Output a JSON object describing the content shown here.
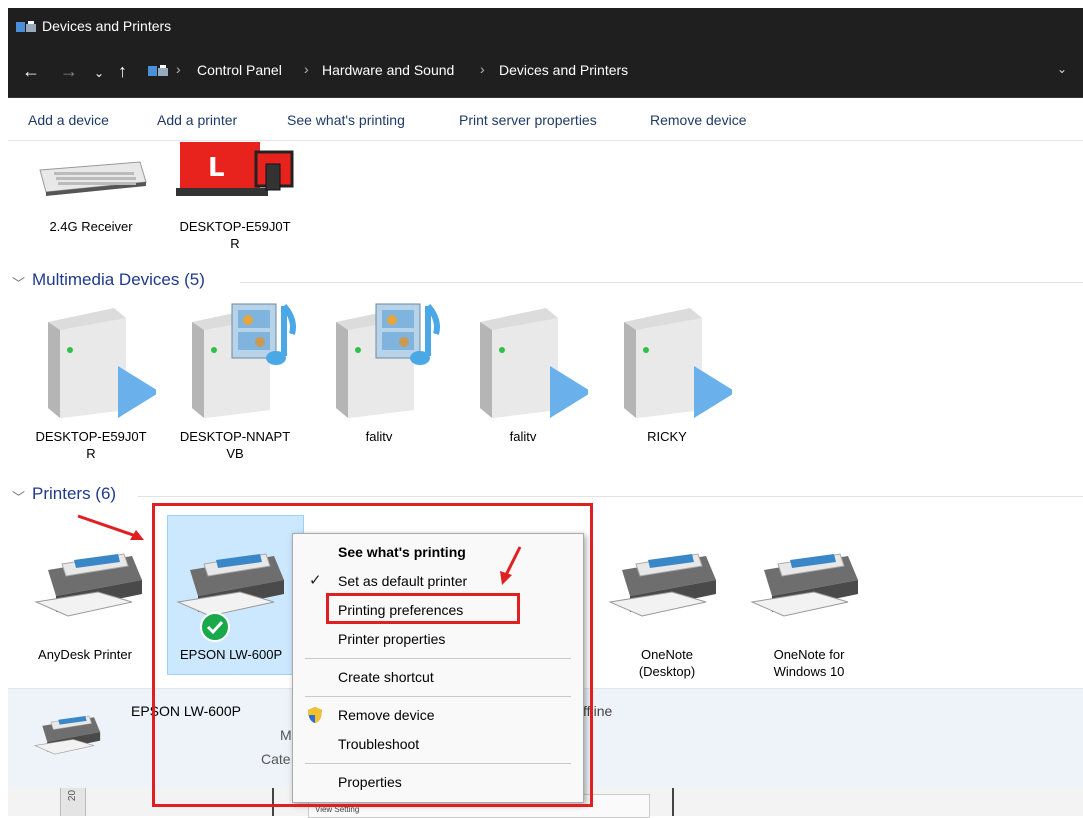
{
  "window": {
    "title": "Devices and Printers"
  },
  "address": {
    "crumbs": [
      "Control Panel",
      "Hardware and Sound",
      "Devices and Printers"
    ],
    "sep": "›"
  },
  "toolbar": {
    "add_device": "Add a device",
    "add_printer": "Add a printer",
    "see_printing": "See what's printing",
    "print_server": "Print server properties",
    "remove_device": "Remove device"
  },
  "devices_top": [
    {
      "label": "2.4G Receiver",
      "icon": "keyboard-icon"
    },
    {
      "label": "DESKTOP-E59J0T\nR",
      "icon": "computer-icon"
    }
  ],
  "multimedia": {
    "title": "Multimedia Devices (5)",
    "items": [
      {
        "label": "DESKTOP-E59J0T\nR",
        "icon": "media-server-play-icon"
      },
      {
        "label": "DESKTOP-NNAPT\nVB",
        "icon": "media-server-music-icon"
      },
      {
        "label": "falitv",
        "icon": "media-server-music-icon"
      },
      {
        "label": "falitv",
        "icon": "media-server-play-icon"
      },
      {
        "label": "RICKY",
        "icon": "media-server-play-icon"
      }
    ]
  },
  "printers": {
    "title": "Printers (6)",
    "items": [
      {
        "label": "AnyDesk Printer",
        "icon": "printer-icon"
      },
      {
        "label": "EPSON LW-600P",
        "icon": "printer-icon",
        "default": true
      },
      {
        "label": "OneNote\n(Desktop)",
        "icon": "printer-icon"
      },
      {
        "label": "OneNote for\nWindows 10",
        "icon": "printer-icon"
      }
    ]
  },
  "details": {
    "name": "EPSON LW-600P",
    "m": "M",
    "category": "Cate",
    "status": "ffline"
  },
  "context_menu": {
    "see_printing": "See what's printing",
    "set_default": "Set as default printer",
    "preferences": "Printing preferences",
    "printer_props": "Printer properties",
    "create_shortcut": "Create shortcut",
    "remove_device": "Remove device",
    "troubleshoot": "Troubleshoot",
    "properties": "Properties"
  },
  "bottom": {
    "num": "20",
    "view_setting": "View Setting"
  },
  "colors": {
    "accent_red": "#e02020",
    "link_blue": "#1e3a8a",
    "selection": "#cce8ff"
  }
}
